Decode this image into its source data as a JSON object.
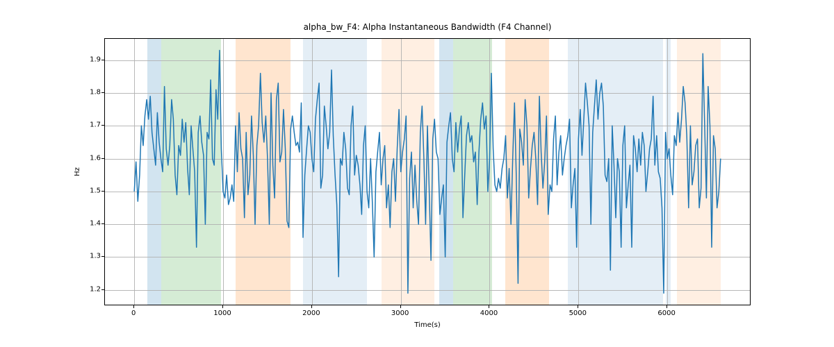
{
  "chart_data": {
    "type": "line",
    "title": "alpha_bw_F4: Alpha Instantaneous Bandwidth (F4 Channel)",
    "xlabel": "Time(s)",
    "ylabel": "Hz",
    "xlim": [
      -330,
      6930
    ],
    "ylim": [
      1.155,
      1.965
    ],
    "xticks": [
      0,
      1000,
      2000,
      3000,
      4000,
      5000,
      6000
    ],
    "yticks": [
      1.2,
      1.3,
      1.4,
      1.5,
      1.6,
      1.7,
      1.8,
      1.9
    ],
    "bands": [
      {
        "start": 150,
        "end": 300,
        "style": "b-blue"
      },
      {
        "start": 300,
        "end": 980,
        "style": "b-green"
      },
      {
        "start": 1140,
        "end": 1760,
        "style": "b-orange"
      },
      {
        "start": 1900,
        "end": 1970,
        "style": "b-bluel"
      },
      {
        "start": 1970,
        "end": 2620,
        "style": "b-bluel"
      },
      {
        "start": 2780,
        "end": 3380,
        "style": "b-orangel"
      },
      {
        "start": 3430,
        "end": 3590,
        "style": "b-blue"
      },
      {
        "start": 3590,
        "end": 4030,
        "style": "b-green"
      },
      {
        "start": 4180,
        "end": 4670,
        "style": "b-orange"
      },
      {
        "start": 4880,
        "end": 5950,
        "style": "b-bluel"
      },
      {
        "start": 5980,
        "end": 6040,
        "style": "b-bluel"
      },
      {
        "start": 6110,
        "end": 6600,
        "style": "b-orangel"
      }
    ],
    "x": [
      0,
      20,
      40,
      60,
      80,
      100,
      120,
      140,
      160,
      180,
      200,
      220,
      240,
      260,
      280,
      300,
      320,
      340,
      360,
      380,
      400,
      420,
      440,
      460,
      480,
      500,
      520,
      540,
      560,
      580,
      600,
      620,
      640,
      660,
      680,
      700,
      720,
      740,
      760,
      780,
      800,
      820,
      840,
      860,
      880,
      900,
      920,
      940,
      960,
      980,
      1000,
      1020,
      1040,
      1060,
      1080,
      1100,
      1120,
      1140,
      1160,
      1180,
      1200,
      1220,
      1240,
      1260,
      1280,
      1300,
      1320,
      1340,
      1360,
      1380,
      1400,
      1420,
      1440,
      1460,
      1480,
      1500,
      1520,
      1540,
      1560,
      1580,
      1600,
      1620,
      1640,
      1660,
      1680,
      1700,
      1720,
      1740,
      1760,
      1780,
      1800,
      1820,
      1840,
      1860,
      1880,
      1900,
      1920,
      1940,
      1960,
      1980,
      2000,
      2020,
      2040,
      2060,
      2080,
      2100,
      2120,
      2140,
      2160,
      2180,
      2200,
      2220,
      2240,
      2260,
      2280,
      2300,
      2320,
      2340,
      2360,
      2380,
      2400,
      2420,
      2440,
      2460,
      2480,
      2500,
      2520,
      2540,
      2560,
      2580,
      2600,
      2620,
      2640,
      2660,
      2680,
      2700,
      2720,
      2740,
      2760,
      2780,
      2800,
      2820,
      2840,
      2860,
      2880,
      2900,
      2920,
      2940,
      2960,
      2980,
      3000,
      3020,
      3040,
      3060,
      3080,
      3100,
      3120,
      3140,
      3160,
      3180,
      3200,
      3220,
      3240,
      3260,
      3280,
      3300,
      3320,
      3340,
      3360,
      3380,
      3400,
      3420,
      3440,
      3460,
      3480,
      3500,
      3520,
      3540,
      3560,
      3580,
      3600,
      3620,
      3640,
      3660,
      3680,
      3700,
      3720,
      3740,
      3760,
      3780,
      3800,
      3820,
      3840,
      3860,
      3880,
      3900,
      3920,
      3940,
      3960,
      3980,
      4000,
      4020,
      4040,
      4060,
      4080,
      4100,
      4120,
      4140,
      4160,
      4180,
      4200,
      4220,
      4240,
      4260,
      4280,
      4300,
      4320,
      4340,
      4360,
      4380,
      4400,
      4420,
      4440,
      4460,
      4480,
      4500,
      4520,
      4540,
      4560,
      4580,
      4600,
      4620,
      4640,
      4660,
      4680,
      4700,
      4720,
      4740,
      4760,
      4780,
      4800,
      4820,
      4840,
      4860,
      4880,
      4900,
      4920,
      4940,
      4960,
      4980,
      5000,
      5020,
      5040,
      5060,
      5080,
      5100,
      5120,
      5140,
      5160,
      5180,
      5200,
      5220,
      5240,
      5260,
      5280,
      5300,
      5320,
      5340,
      5360,
      5380,
      5400,
      5420,
      5440,
      5460,
      5480,
      5500,
      5520,
      5540,
      5560,
      5580,
      5600,
      5620,
      5640,
      5660,
      5680,
      5700,
      5720,
      5740,
      5760,
      5780,
      5800,
      5820,
      5840,
      5860,
      5880,
      5900,
      5920,
      5940,
      5960,
      5980,
      6000,
      6020,
      6040,
      6060,
      6080,
      6100,
      6120,
      6140,
      6160,
      6180,
      6200,
      6220,
      6240,
      6260,
      6280,
      6300,
      6320,
      6340,
      6360,
      6380,
      6400,
      6420,
      6440,
      6460,
      6480,
      6500,
      6520,
      6540,
      6560,
      6580,
      6600
    ],
    "y": [
      1.5,
      1.59,
      1.47,
      1.55,
      1.7,
      1.64,
      1.73,
      1.78,
      1.72,
      1.79,
      1.68,
      1.63,
      1.58,
      1.74,
      1.65,
      1.6,
      1.56,
      1.82,
      1.63,
      1.58,
      1.64,
      1.78,
      1.72,
      1.55,
      1.49,
      1.64,
      1.61,
      1.72,
      1.65,
      1.71,
      1.57,
      1.49,
      1.7,
      1.63,
      1.56,
      1.33,
      1.68,
      1.73,
      1.65,
      1.61,
      1.4,
      1.68,
      1.66,
      1.84,
      1.6,
      1.58,
      1.81,
      1.72,
      1.93,
      1.63,
      1.5,
      1.48,
      1.55,
      1.46,
      1.48,
      1.52,
      1.47,
      1.7,
      1.56,
      1.74,
      1.63,
      1.6,
      1.42,
      1.68,
      1.49,
      1.55,
      1.73,
      1.61,
      1.4,
      1.64,
      1.7,
      1.86,
      1.71,
      1.65,
      1.73,
      1.6,
      1.4,
      1.8,
      1.58,
      1.48,
      1.78,
      1.83,
      1.59,
      1.62,
      1.75,
      1.63,
      1.41,
      1.39,
      1.69,
      1.73,
      1.68,
      1.64,
      1.65,
      1.62,
      1.77,
      1.36,
      1.55,
      1.63,
      1.7,
      1.68,
      1.6,
      1.56,
      1.72,
      1.78,
      1.83,
      1.51,
      1.55,
      1.76,
      1.7,
      1.63,
      1.68,
      1.87,
      1.67,
      1.55,
      1.46,
      1.24,
      1.6,
      1.58,
      1.68,
      1.63,
      1.51,
      1.49,
      1.7,
      1.76,
      1.55,
      1.61,
      1.58,
      1.52,
      1.43,
      1.64,
      1.7,
      1.5,
      1.45,
      1.6,
      1.47,
      1.3,
      1.56,
      1.62,
      1.68,
      1.52,
      1.6,
      1.64,
      1.45,
      1.52,
      1.39,
      1.56,
      1.6,
      1.47,
      1.63,
      1.75,
      1.56,
      1.62,
      1.66,
      1.73,
      1.19,
      1.54,
      1.62,
      1.45,
      1.58,
      1.47,
      1.4,
      1.68,
      1.76,
      1.6,
      1.4,
      1.7,
      1.5,
      1.29,
      1.66,
      1.72,
      1.62,
      1.6,
      1.43,
      1.48,
      1.52,
      1.3,
      1.65,
      1.7,
      1.74,
      1.6,
      1.56,
      1.71,
      1.62,
      1.69,
      1.73,
      1.42,
      1.55,
      1.67,
      1.71,
      1.65,
      1.67,
      1.59,
      1.62,
      1.46,
      1.62,
      1.72,
      1.77,
      1.69,
      1.73,
      1.5,
      1.6,
      1.86,
      1.63,
      1.52,
      1.5,
      1.54,
      1.51,
      1.57,
      1.6,
      1.67,
      1.48,
      1.57,
      1.4,
      1.6,
      1.77,
      1.55,
      1.22,
      1.69,
      1.65,
      1.58,
      1.78,
      1.7,
      1.48,
      1.57,
      1.64,
      1.68,
      1.6,
      1.46,
      1.79,
      1.62,
      1.51,
      1.59,
      1.73,
      1.43,
      1.52,
      1.5,
      1.66,
      1.73,
      1.52,
      1.62,
      1.67,
      1.55,
      1.6,
      1.64,
      1.67,
      1.72,
      1.45,
      1.52,
      1.57,
      1.33,
      1.66,
      1.75,
      1.61,
      1.72,
      1.83,
      1.77,
      1.7,
      1.4,
      1.68,
      1.76,
      1.84,
      1.72,
      1.8,
      1.83,
      1.76,
      1.55,
      1.53,
      1.6,
      1.26,
      1.7,
      1.58,
      1.42,
      1.6,
      1.56,
      1.33,
      1.64,
      1.7,
      1.45,
      1.52,
      1.58,
      1.33,
      1.67,
      1.63,
      1.56,
      1.66,
      1.58,
      1.68,
      1.64,
      1.5,
      1.56,
      1.63,
      1.66,
      1.79,
      1.58,
      1.67,
      1.56,
      1.54,
      1.45,
      1.19,
      1.68,
      1.6,
      1.63,
      1.55,
      1.49,
      1.67,
      1.64,
      1.74,
      1.65,
      1.72,
      1.82,
      1.77,
      1.67,
      1.45,
      1.7,
      1.52,
      1.56,
      1.64,
      1.66,
      1.45,
      1.51,
      1.92,
      1.71,
      1.48,
      1.82,
      1.7,
      1.33,
      1.67,
      1.63,
      1.45,
      1.5,
      1.6
    ]
  }
}
